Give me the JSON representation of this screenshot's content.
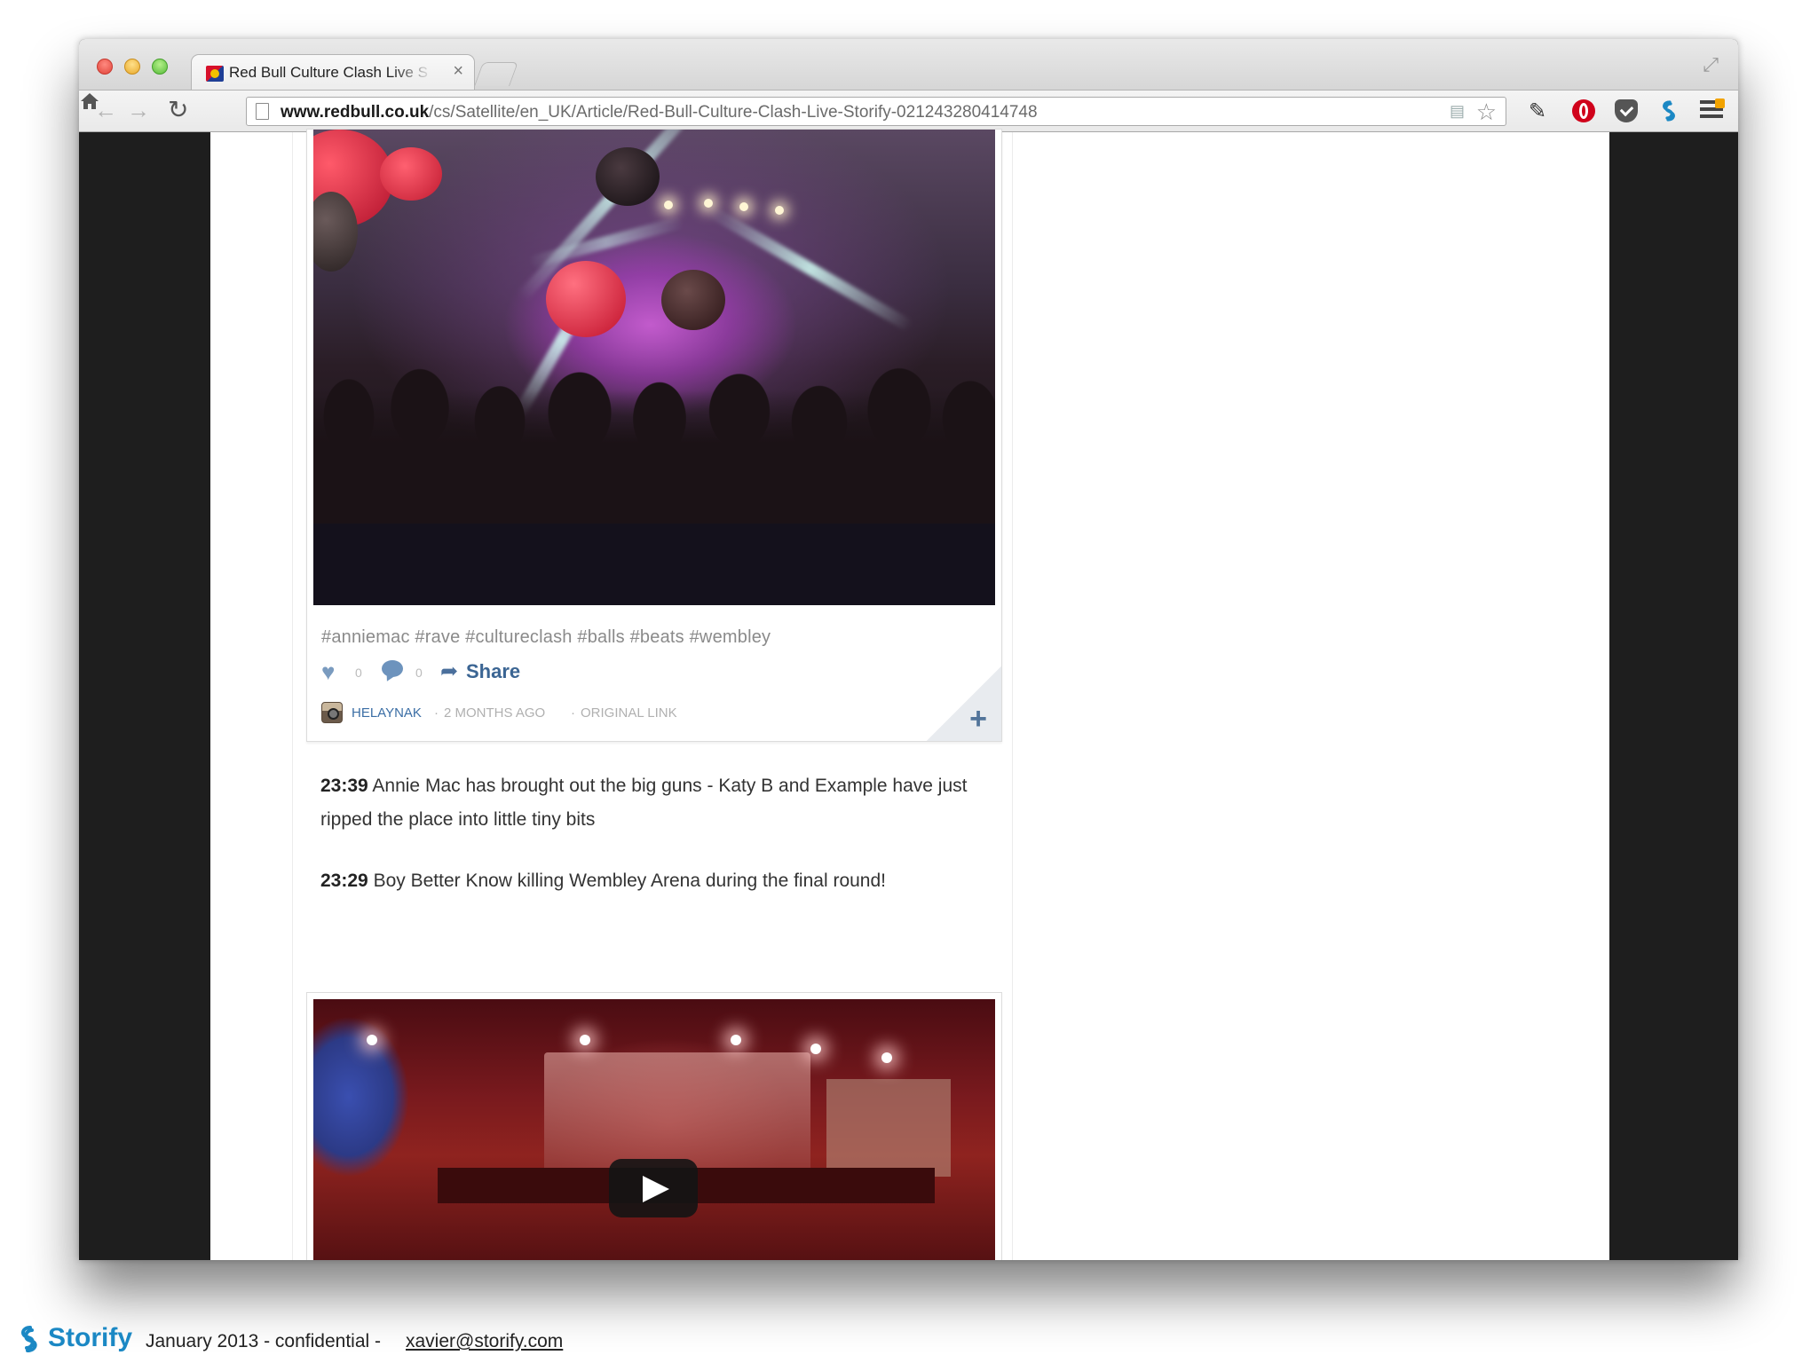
{
  "browser": {
    "tab_title": "Red Bull Culture Clash Live S",
    "tab_close": "×",
    "url_domain": "www.redbull.co.uk",
    "url_path": "/cs/Satellite/en_UK/Article/Red-Bull-Culture-Clash-Live-Storify-021243280414748",
    "icons": [
      "back-icon",
      "forward-icon",
      "reload-icon",
      "home-icon",
      "page-icon",
      "star-icon",
      "pen-icon",
      "opera-icon",
      "pocket-icon",
      "storify-icon",
      "menu-icon"
    ]
  },
  "story": {
    "card1": {
      "hashtags": "#anniemac #rave #cultureclash #balls #beats #wembley",
      "like_count": "0",
      "comment_count": "0",
      "share_label": "Share",
      "author": "HELAYNAK",
      "separator": "·",
      "time_ago": "2 MONTHS AGO",
      "original_link": "ORIGINAL LINK",
      "add_label": "+"
    },
    "updates": [
      {
        "time": "23:39",
        "text": "Annie Mac has brought out the big guns - Katy B and Example have just ripped the place into little tiny bits"
      },
      {
        "time": "23:29",
        "text": "Boy Better Know killing Wembley Arena during the final round!"
      }
    ]
  },
  "footer": {
    "brand": "Storify",
    "text": "January 2013 - confidential - ",
    "email": "xavier@storify.com"
  },
  "colors": {
    "storify_blue": "#1b88c4",
    "link_blue": "#3b6ea5",
    "share_blue": "#3b6593"
  }
}
